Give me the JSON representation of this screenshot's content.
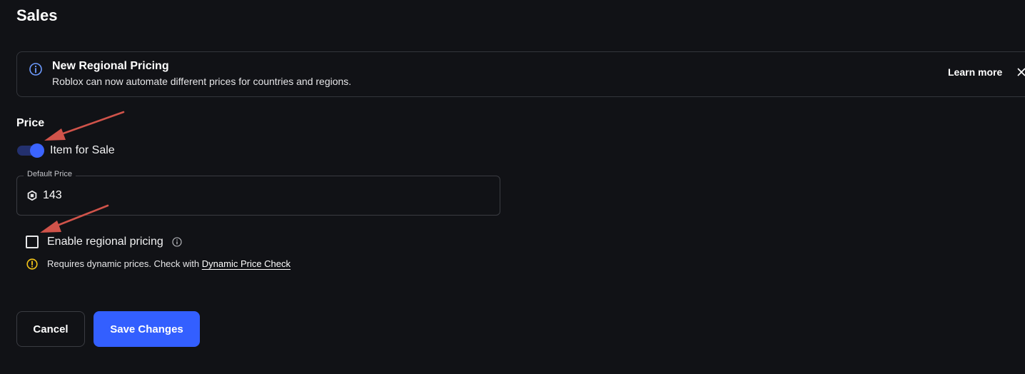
{
  "page": {
    "title": "Sales"
  },
  "banner": {
    "icon": "info-icon",
    "title": "New Regional Pricing",
    "body": "Roblox can now automate different prices for countries and regions.",
    "learn_more": "Learn more",
    "close_icon": "close-icon"
  },
  "price": {
    "heading": "Price",
    "toggle": {
      "label": "Item for Sale",
      "checked": true,
      "color_on": "#3b64ff",
      "track_color": "#23306e"
    },
    "default_price": {
      "legend": "Default Price",
      "currency_icon": "robux-icon",
      "value": "143"
    },
    "regional": {
      "label": "Enable regional pricing",
      "checked": false,
      "info_icon": "info-icon",
      "warning_icon": "warning-icon",
      "warning_text": "Requires dynamic prices. Check with",
      "warning_link": "Dynamic Price Check",
      "warning_color": "#f5c518"
    }
  },
  "actions": {
    "cancel": "Cancel",
    "save": "Save Changes",
    "accent": "#335fff"
  },
  "annotations": {
    "arrow_color": "#d0534a"
  }
}
